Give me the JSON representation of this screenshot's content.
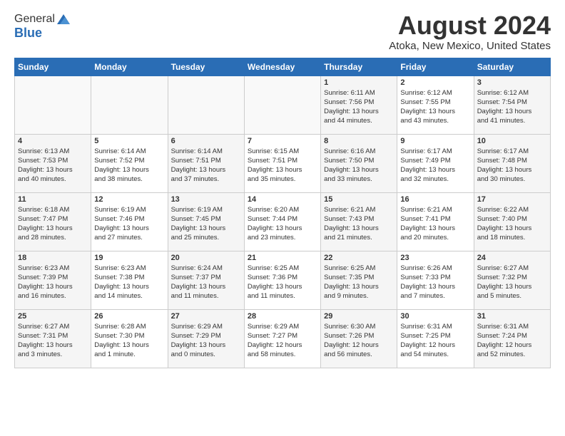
{
  "header": {
    "logo_general": "General",
    "logo_blue": "Blue",
    "month_title": "August 2024",
    "location": "Atoka, New Mexico, United States"
  },
  "days_of_week": [
    "Sunday",
    "Monday",
    "Tuesday",
    "Wednesday",
    "Thursday",
    "Friday",
    "Saturday"
  ],
  "weeks": [
    [
      {
        "day": "",
        "info": ""
      },
      {
        "day": "",
        "info": ""
      },
      {
        "day": "",
        "info": ""
      },
      {
        "day": "",
        "info": ""
      },
      {
        "day": "1",
        "info": "Sunrise: 6:11 AM\nSunset: 7:56 PM\nDaylight: 13 hours\nand 44 minutes."
      },
      {
        "day": "2",
        "info": "Sunrise: 6:12 AM\nSunset: 7:55 PM\nDaylight: 13 hours\nand 43 minutes."
      },
      {
        "day": "3",
        "info": "Sunrise: 6:12 AM\nSunset: 7:54 PM\nDaylight: 13 hours\nand 41 minutes."
      }
    ],
    [
      {
        "day": "4",
        "info": "Sunrise: 6:13 AM\nSunset: 7:53 PM\nDaylight: 13 hours\nand 40 minutes."
      },
      {
        "day": "5",
        "info": "Sunrise: 6:14 AM\nSunset: 7:52 PM\nDaylight: 13 hours\nand 38 minutes."
      },
      {
        "day": "6",
        "info": "Sunrise: 6:14 AM\nSunset: 7:51 PM\nDaylight: 13 hours\nand 37 minutes."
      },
      {
        "day": "7",
        "info": "Sunrise: 6:15 AM\nSunset: 7:51 PM\nDaylight: 13 hours\nand 35 minutes."
      },
      {
        "day": "8",
        "info": "Sunrise: 6:16 AM\nSunset: 7:50 PM\nDaylight: 13 hours\nand 33 minutes."
      },
      {
        "day": "9",
        "info": "Sunrise: 6:17 AM\nSunset: 7:49 PM\nDaylight: 13 hours\nand 32 minutes."
      },
      {
        "day": "10",
        "info": "Sunrise: 6:17 AM\nSunset: 7:48 PM\nDaylight: 13 hours\nand 30 minutes."
      }
    ],
    [
      {
        "day": "11",
        "info": "Sunrise: 6:18 AM\nSunset: 7:47 PM\nDaylight: 13 hours\nand 28 minutes."
      },
      {
        "day": "12",
        "info": "Sunrise: 6:19 AM\nSunset: 7:46 PM\nDaylight: 13 hours\nand 27 minutes."
      },
      {
        "day": "13",
        "info": "Sunrise: 6:19 AM\nSunset: 7:45 PM\nDaylight: 13 hours\nand 25 minutes."
      },
      {
        "day": "14",
        "info": "Sunrise: 6:20 AM\nSunset: 7:44 PM\nDaylight: 13 hours\nand 23 minutes."
      },
      {
        "day": "15",
        "info": "Sunrise: 6:21 AM\nSunset: 7:43 PM\nDaylight: 13 hours\nand 21 minutes."
      },
      {
        "day": "16",
        "info": "Sunrise: 6:21 AM\nSunset: 7:41 PM\nDaylight: 13 hours\nand 20 minutes."
      },
      {
        "day": "17",
        "info": "Sunrise: 6:22 AM\nSunset: 7:40 PM\nDaylight: 13 hours\nand 18 minutes."
      }
    ],
    [
      {
        "day": "18",
        "info": "Sunrise: 6:23 AM\nSunset: 7:39 PM\nDaylight: 13 hours\nand 16 minutes."
      },
      {
        "day": "19",
        "info": "Sunrise: 6:23 AM\nSunset: 7:38 PM\nDaylight: 13 hours\nand 14 minutes."
      },
      {
        "day": "20",
        "info": "Sunrise: 6:24 AM\nSunset: 7:37 PM\nDaylight: 13 hours\nand 11 minutes."
      },
      {
        "day": "21",
        "info": "Sunrise: 6:25 AM\nSunset: 7:36 PM\nDaylight: 13 hours\nand 11 minutes."
      },
      {
        "day": "22",
        "info": "Sunrise: 6:25 AM\nSunset: 7:35 PM\nDaylight: 13 hours\nand 9 minutes."
      },
      {
        "day": "23",
        "info": "Sunrise: 6:26 AM\nSunset: 7:33 PM\nDaylight: 13 hours\nand 7 minutes."
      },
      {
        "day": "24",
        "info": "Sunrise: 6:27 AM\nSunset: 7:32 PM\nDaylight: 13 hours\nand 5 minutes."
      }
    ],
    [
      {
        "day": "25",
        "info": "Sunrise: 6:27 AM\nSunset: 7:31 PM\nDaylight: 13 hours\nand 3 minutes."
      },
      {
        "day": "26",
        "info": "Sunrise: 6:28 AM\nSunset: 7:30 PM\nDaylight: 13 hours\nand 1 minute."
      },
      {
        "day": "27",
        "info": "Sunrise: 6:29 AM\nSunset: 7:29 PM\nDaylight: 13 hours\nand 0 minutes."
      },
      {
        "day": "28",
        "info": "Sunrise: 6:29 AM\nSunset: 7:27 PM\nDaylight: 12 hours\nand 58 minutes."
      },
      {
        "day": "29",
        "info": "Sunrise: 6:30 AM\nSunset: 7:26 PM\nDaylight: 12 hours\nand 56 minutes."
      },
      {
        "day": "30",
        "info": "Sunrise: 6:31 AM\nSunset: 7:25 PM\nDaylight: 12 hours\nand 54 minutes."
      },
      {
        "day": "31",
        "info": "Sunrise: 6:31 AM\nSunset: 7:24 PM\nDaylight: 12 hours\nand 52 minutes."
      }
    ]
  ]
}
